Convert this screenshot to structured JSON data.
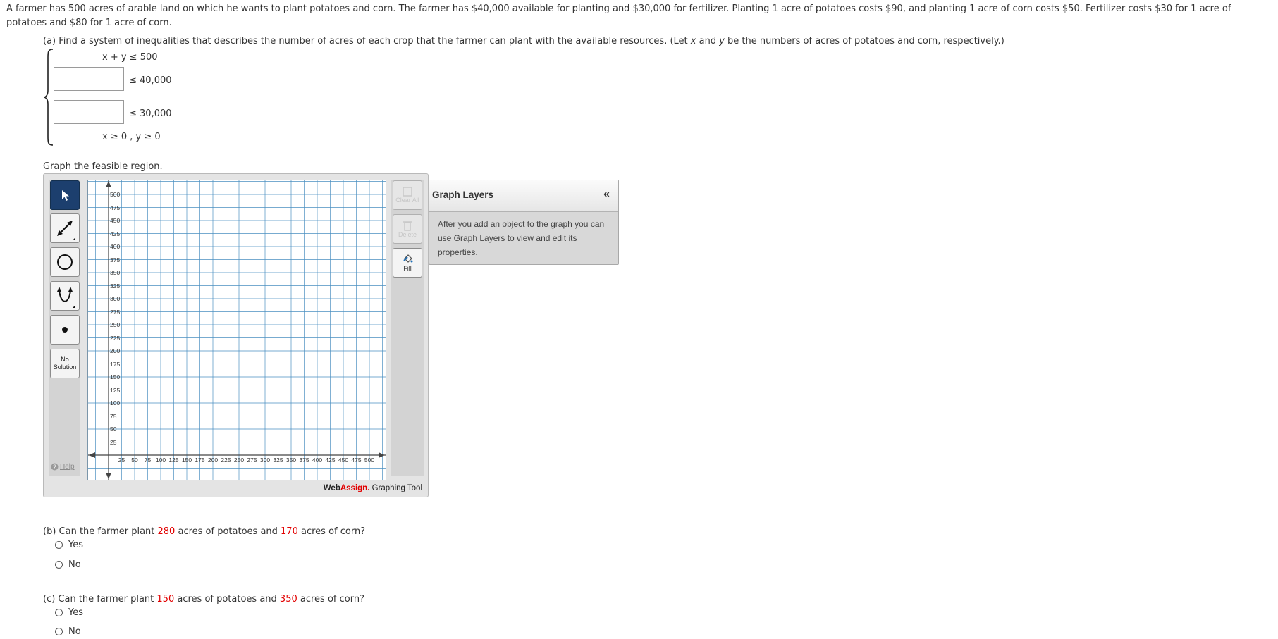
{
  "problem_text": "A farmer has 500 acres of arable land on which he wants to plant potatoes and corn. The farmer has $40,000 available for planting and $30,000 for fertilizer. Planting 1 acre of potatoes costs $90, and planting 1 acre of corn costs $50. Fertilizer costs $30 for 1 acre of potatoes and $80 for 1 acre of corn.",
  "part_a": {
    "prompt_1": "(a) Find a system of inequalities that describes the number of acres of each crop that the farmer can plant with the available resources. (Let ",
    "var_x": "x",
    "prompt_2": " and ",
    "var_y": "y",
    "prompt_3": " be the numbers of acres of potatoes and corn, respectively.)",
    "ineq1": "x + y ≤ 500",
    "ineq2_rhs": "≤ 40,000",
    "ineq3_rhs": "≤ 30,000",
    "ineq4": "x ≥ 0 , y ≥ 0",
    "graph_prompt": "Graph the feasible region."
  },
  "graph_tool": {
    "no_solution": [
      "No",
      "Solution"
    ],
    "help": "Help",
    "clear_all": "Clear All",
    "delete": "Delete",
    "fill": "Fill",
    "brand_web": "Web",
    "brand_assign": "Assign.",
    "brand_tool": " Graphing Tool",
    "y_ticks": [
      "500",
      "475",
      "450",
      "425",
      "400",
      "375",
      "350",
      "325",
      "300",
      "275",
      "250",
      "225",
      "200",
      "175",
      "150",
      "125",
      "100",
      "75",
      "50",
      "25"
    ],
    "x_ticks": [
      "25",
      "50",
      "75",
      "100",
      "125",
      "150",
      "175",
      "200",
      "225",
      "250",
      "275",
      "300",
      "325",
      "350",
      "375",
      "400",
      "425",
      "450",
      "475",
      "500"
    ],
    "colors": {
      "grid": "#4a8fc0",
      "selected_tool": "#1c3f6e",
      "brand_red": "#e20000"
    }
  },
  "graph_layers": {
    "title": "Graph Layers",
    "collapse": "«",
    "info": "After you add an object to the graph you can use Graph Layers to view and edit its properties."
  },
  "part_b": {
    "q1": "(b) Can the farmer plant ",
    "n1": "280",
    "q2": " acres of potatoes and ",
    "n2": "170",
    "q3": " acres of corn?",
    "yes": "Yes",
    "no": "No"
  },
  "part_c": {
    "q1": "(c) Can the farmer plant ",
    "n1": "150",
    "q2": " acres of potatoes and ",
    "n2": "350",
    "q3": " acres of corn?",
    "yes": "Yes",
    "no": "No"
  }
}
